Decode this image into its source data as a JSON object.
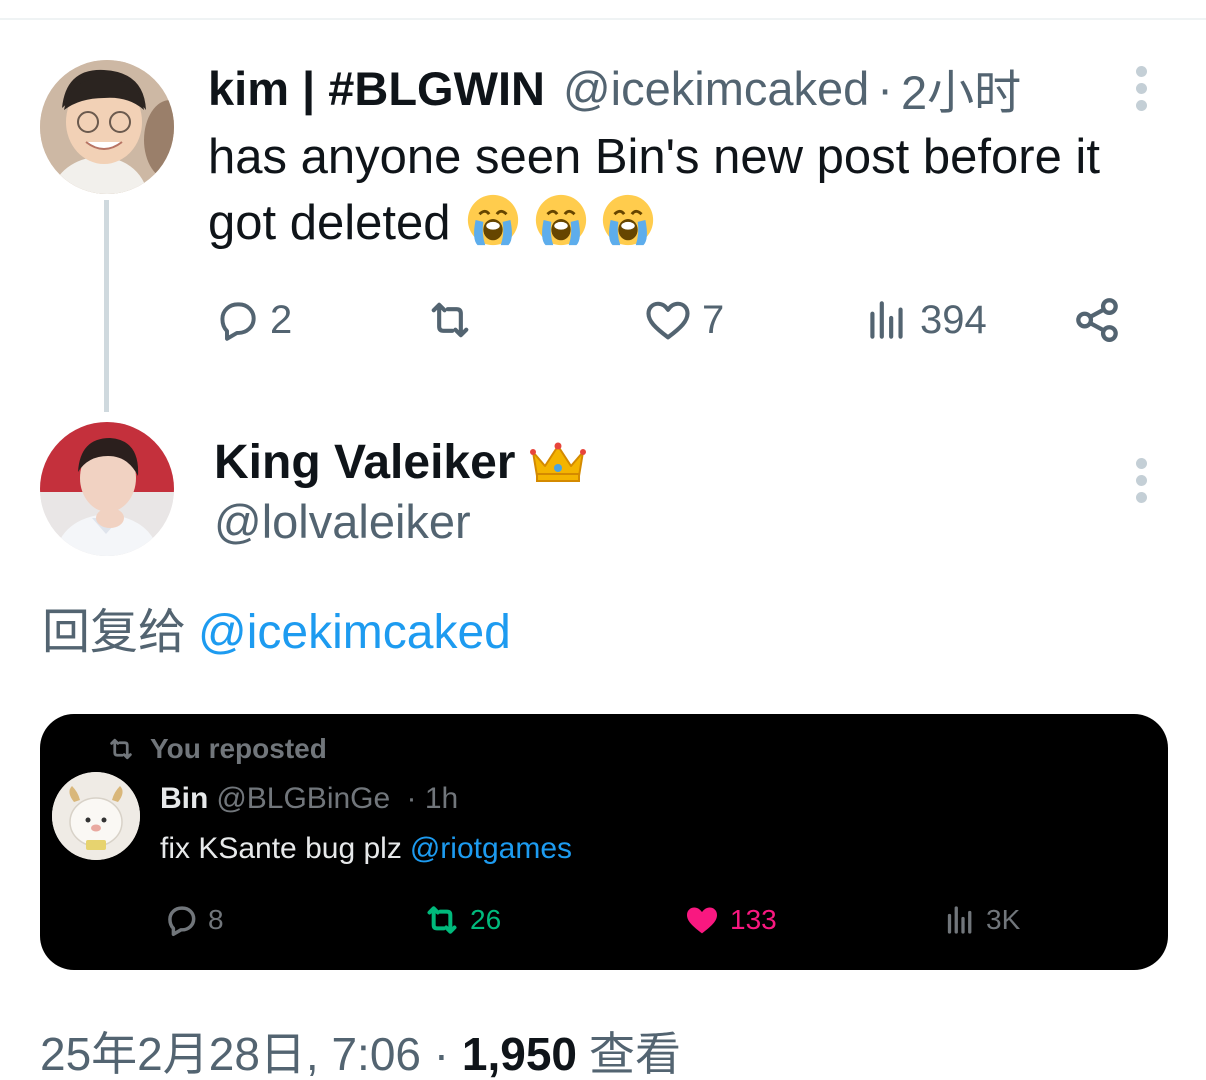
{
  "parent_tweet": {
    "name": "kim | #BLGWIN",
    "handle": "@icekimcaked",
    "separator": "·",
    "time": "2小时",
    "text_line1": "has anyone seen Bin's new post before it",
    "text_line2": "got deleted",
    "emoji": [
      "loudly-crying-face",
      "loudly-crying-face",
      "loudly-crying-face"
    ],
    "replies": "2",
    "likes": "7",
    "views": "394"
  },
  "reply_tweet": {
    "name": "King Valeiker",
    "badge": "crown",
    "handle": "@lolvaleiker",
    "replying_to_label": "回复给",
    "replying_to_handle": "@icekimcaked"
  },
  "embedded_tweet": {
    "repost_label": "You reposted",
    "name": "Bin",
    "handle": "@BLGBinGe",
    "time": "· 1h",
    "text": "fix KSante bug plz",
    "mention": "@riotgames",
    "replies": "8",
    "retweets": "26",
    "likes": "133",
    "views": "3K"
  },
  "footer": {
    "datetime": "25年2月28日, 7:06 · ",
    "views": "1,950",
    "views_label": "查看"
  },
  "colors": {
    "text": "#0f1419",
    "secondary": "#536471",
    "link": "#1d9bf0",
    "retweet_green": "#00ba7c",
    "like_pink": "#f91880",
    "card_bg": "#000000"
  }
}
